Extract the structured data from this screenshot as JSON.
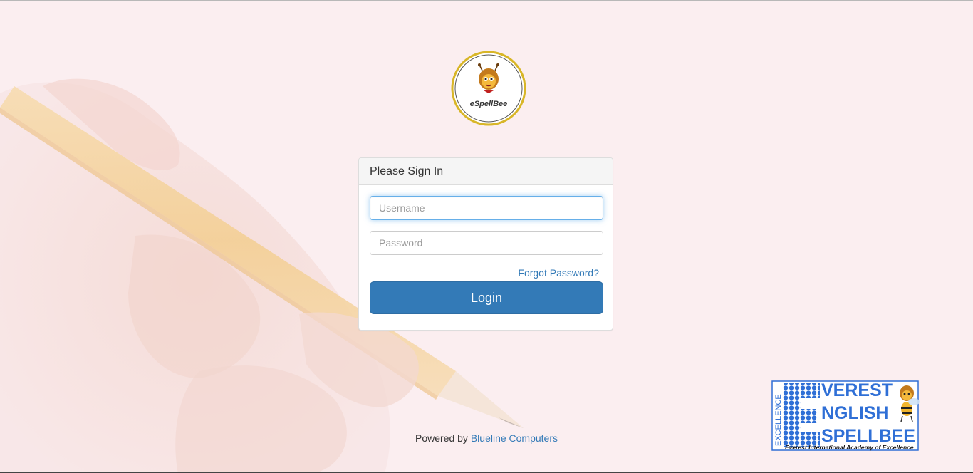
{
  "login_panel": {
    "heading": "Please Sign In",
    "username_placeholder": "Username",
    "username_value": "",
    "password_placeholder": "Password",
    "password_value": "",
    "forgot_label": "Forgot Password?",
    "login_label": "Login"
  },
  "logo": {
    "text": "eSpellBee"
  },
  "footer": {
    "prefix": "Powered by",
    "link_label": "Blueline Computers"
  },
  "brand": {
    "line1": "VEREST",
    "line2": "NGLISH",
    "line3": "SPELLBEE",
    "side_text": "EXCELLENCE",
    "tagline": "Everest International Academy of Excellence"
  },
  "colors": {
    "primary": "#337ab7",
    "page_background": "#fbeef0",
    "logo_ring": "#d8b628"
  }
}
